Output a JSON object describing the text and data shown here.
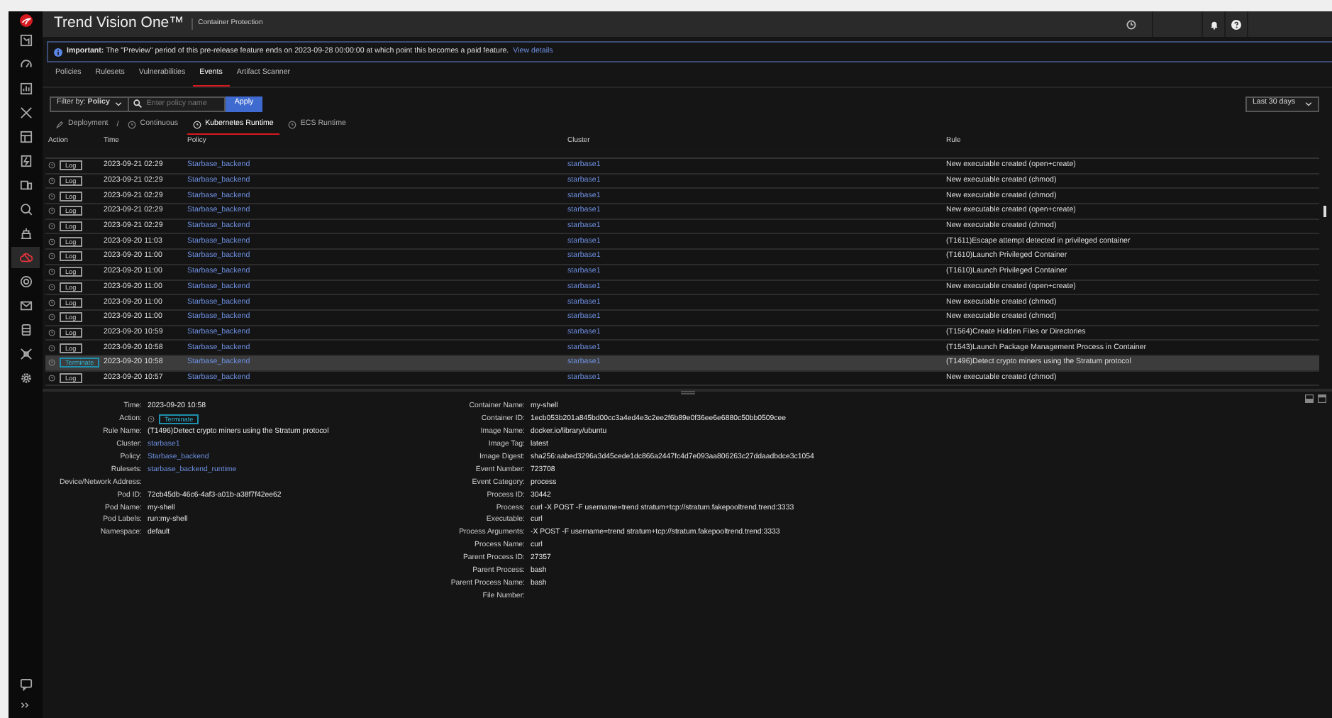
{
  "sidebar": {
    "items": [
      {
        "selected": false
      },
      {
        "selected": false
      },
      {
        "selected": false
      },
      {
        "selected": false
      },
      {
        "selected": false
      },
      {
        "selected": false
      },
      {
        "selected": false
      },
      {
        "selected": false
      },
      {
        "selected": false
      },
      {
        "selected": true
      },
      {
        "selected": false
      },
      {
        "selected": false
      },
      {
        "selected": false
      },
      {
        "selected": false
      },
      {
        "selected": false
      }
    ]
  },
  "topbar": {
    "title": "Trend Vision One™",
    "subtitle": "Container Protection"
  },
  "banner": {
    "text": "**Important:** The \"Preview\" period of this pre-release feature ends on 2023-09-28 00:00:00 at which point this becomes a paid feature.",
    "link": "View details"
  },
  "tabs": [
    {
      "label": "Policies",
      "selected": false
    },
    {
      "label": "Rulesets",
      "selected": false
    },
    {
      "label": "Vulnerabilities",
      "selected": false
    },
    {
      "label": "Events",
      "selected": true
    },
    {
      "label": "Artifact Scanner",
      "selected": false
    }
  ],
  "filter": {
    "dropdown": "Filter by: **Policy**",
    "placeholder": "Enter policy name",
    "button": "Apply",
    "range": "Last 30 days"
  },
  "runtime_tabs": {
    "separator": "/",
    "items": [
      {
        "label": "Deployment",
        "selected": false
      },
      {
        "label": "Continuous",
        "selected": false
      },
      {
        "label": "Kubernetes Runtime",
        "selected": true
      },
      {
        "label": "ECS Runtime",
        "selected": false
      }
    ]
  },
  "table": {
    "columns": [
      "Action",
      "Time",
      "Policy",
      "Cluster",
      "Rule"
    ],
    "rows": [
      {
        "action": "Log",
        "kind": "log",
        "time": "2023-09-21 02:29",
        "policy": "Starbase_backend",
        "cluster": "starbase1",
        "rule": "New executable created (open+create)",
        "selected": false
      },
      {
        "action": "Log",
        "kind": "log",
        "time": "2023-09-21 02:29",
        "policy": "Starbase_backend",
        "cluster": "starbase1",
        "rule": "New executable created (chmod)",
        "selected": false
      },
      {
        "action": "Log",
        "kind": "log",
        "time": "2023-09-21 02:29",
        "policy": "Starbase_backend",
        "cluster": "starbase1",
        "rule": "New executable created (chmod)",
        "selected": false
      },
      {
        "action": "Log",
        "kind": "log",
        "time": "2023-09-21 02:29",
        "policy": "Starbase_backend",
        "cluster": "starbase1",
        "rule": "New executable created (open+create)",
        "selected": false
      },
      {
        "action": "Log",
        "kind": "log",
        "time": "2023-09-21 02:29",
        "policy": "Starbase_backend",
        "cluster": "starbase1",
        "rule": "New executable created (chmod)",
        "selected": false
      },
      {
        "action": "Log",
        "kind": "log",
        "time": "2023-09-20 11:03",
        "policy": "Starbase_backend",
        "cluster": "starbase1",
        "rule": "(T1611)Escape attempt detected in privileged container",
        "selected": false
      },
      {
        "action": "Log",
        "kind": "log",
        "time": "2023-09-20 11:00",
        "policy": "Starbase_backend",
        "cluster": "starbase1",
        "rule": "(T1610)Launch Privileged Container",
        "selected": false
      },
      {
        "action": "Log",
        "kind": "log",
        "time": "2023-09-20 11:00",
        "policy": "Starbase_backend",
        "cluster": "starbase1",
        "rule": "(T1610)Launch Privileged Container",
        "selected": false
      },
      {
        "action": "Log",
        "kind": "log",
        "time": "2023-09-20 11:00",
        "policy": "Starbase_backend",
        "cluster": "starbase1",
        "rule": "New executable created (open+create)",
        "selected": false
      },
      {
        "action": "Log",
        "kind": "log",
        "time": "2023-09-20 11:00",
        "policy": "Starbase_backend",
        "cluster": "starbase1",
        "rule": "New executable created (chmod)",
        "selected": false
      },
      {
        "action": "Log",
        "kind": "log",
        "time": "2023-09-20 11:00",
        "policy": "Starbase_backend",
        "cluster": "starbase1",
        "rule": "New executable created (chmod)",
        "selected": false
      },
      {
        "action": "Log",
        "kind": "log",
        "time": "2023-09-20 10:59",
        "policy": "Starbase_backend",
        "cluster": "starbase1",
        "rule": "(T1564)Create Hidden Files or Directories",
        "selected": false
      },
      {
        "action": "Log",
        "kind": "log",
        "time": "2023-09-20 10:58",
        "policy": "Starbase_backend",
        "cluster": "starbase1",
        "rule": "(T1543)Launch Package Management Process in Container",
        "selected": false
      },
      {
        "action": "Terminate",
        "kind": "terminate",
        "time": "2023-09-20 10:58",
        "policy": "Starbase_backend",
        "cluster": "starbase1",
        "rule": "(T1496)Detect crypto miners using the Stratum protocol",
        "selected": true
      },
      {
        "action": "Log",
        "kind": "log",
        "time": "2023-09-20 10:57",
        "policy": "Starbase_backend",
        "cluster": "starbase1",
        "rule": "New executable created (chmod)",
        "selected": false
      }
    ]
  },
  "details": {
    "left": [
      {
        "label": "Time:",
        "value": "2023-09-20 10:58"
      },
      {
        "label": "Action:",
        "value": "Terminate",
        "kind": "terminate"
      },
      {
        "label": "Rule Name:",
        "value": "(T1496)Detect crypto miners using the Stratum protocol"
      },
      {
        "label": "Cluster:",
        "value": "starbase1",
        "kind": "link"
      },
      {
        "label": "Policy:",
        "value": "Starbase_backend",
        "kind": "link"
      },
      {
        "label": "Rulesets:",
        "value": "starbase_backend_runtime",
        "kind": "link"
      },
      {
        "label": "Device/Network Address:"
      },
      {
        "label": "Pod ID:",
        "value": "72cb45db-46c6-4af3-a01b-a38f7f42ee62"
      },
      {
        "label": "Pod Name:",
        "value": "my-shell"
      },
      {
        "label": "Pod Labels:",
        "value": "run:my-shell"
      },
      {
        "label": "Namespace:",
        "value": "default"
      }
    ],
    "right": [
      {
        "label": "Container Name:",
        "value": "my-shell"
      },
      {
        "label": "Container ID:",
        "value": "1ecb053b201a845bd00cc3a4ed4e3c2ee2f6b89e0f36ee6e6880c50bb0509cee"
      },
      {
        "label": "Image Name:",
        "value": "docker.io/library/ubuntu"
      },
      {
        "label": "Image Tag:",
        "value": "latest"
      },
      {
        "label": "Image Digest:",
        "value": "sha256:aabed3296a3d45cede1dc866a2447fc4d7e093aa806263c27ddaadbdce3c1054"
      },
      {
        "label": "Event Number:",
        "value": "723708"
      },
      {
        "label": "Event Category:",
        "value": "process"
      },
      {
        "label": "Process ID:",
        "value": "30442"
      },
      {
        "label": "Process:",
        "value": "curl -X POST -F username=trend stratum+tcp://stratum.fakepooltrend.trend:3333"
      },
      {
        "label": "Executable:",
        "value": "curl"
      },
      {
        "label": "Process Arguments:",
        "value": "-X POST -F username=trend stratum+tcp://stratum.fakepooltrend.trend:3333"
      },
      {
        "label": "Process Name:",
        "value": "curl"
      },
      {
        "label": "Parent Process ID:",
        "value": "27357"
      },
      {
        "label": "Parent Process:",
        "value": "bash"
      },
      {
        "label": "Parent Process Name:",
        "value": "bash"
      },
      {
        "label": "File Number:"
      }
    ]
  }
}
